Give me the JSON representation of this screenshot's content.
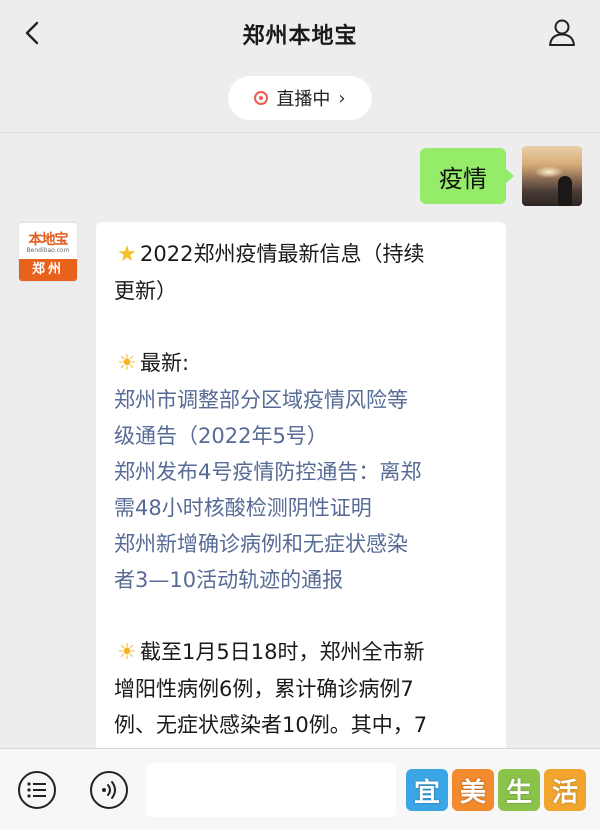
{
  "header": {
    "title": "郑州本地宝"
  },
  "live": {
    "label": "直播中",
    "chevron": "›"
  },
  "my_message": {
    "text": "疫情"
  },
  "bot_avatar": {
    "logo_top": "本地宝",
    "logo_mid": "Bendibao.com",
    "logo_bottom": "郑州"
  },
  "bot_message": {
    "lines": [
      {
        "icon": "star-icon",
        "text": "2022郑州疫情最新信息（持续"
      },
      {
        "text": "更新）"
      },
      {
        "text": ""
      },
      {
        "icon": "sun-icon",
        "text": "最新:"
      },
      {
        "text": "郑州市调整部分区域疫情风险等",
        "link": true
      },
      {
        "text": "级通告（2022年5号）",
        "link": true
      },
      {
        "text": "郑州发布4号疫情防控通告：离郑",
        "link": true
      },
      {
        "text": "需48小时核酸检测阴性证明",
        "link": true
      },
      {
        "text": "郑州新增确诊病例和无症状感染",
        "link": true
      },
      {
        "text": "者3—10活动轨迹的通报",
        "link": true
      },
      {
        "text": ""
      },
      {
        "icon": "sun-icon",
        "text": "截至1月5日18时，郑州全市新"
      },
      {
        "text": "增阳性病例6例，累计确诊病例7"
      },
      {
        "text": "例、无症状感染者10例。其中，7"
      }
    ]
  },
  "watermark": {
    "chars": [
      "宜",
      "美",
      "生",
      "活"
    ],
    "colors": [
      "#3aa6e6",
      "#f28a2e",
      "#8bc34a",
      "#f2a52e"
    ]
  },
  "colors": {
    "bubble_green": "#95ec69",
    "link_blue": "#576b95",
    "live_red": "#f05a4a"
  }
}
